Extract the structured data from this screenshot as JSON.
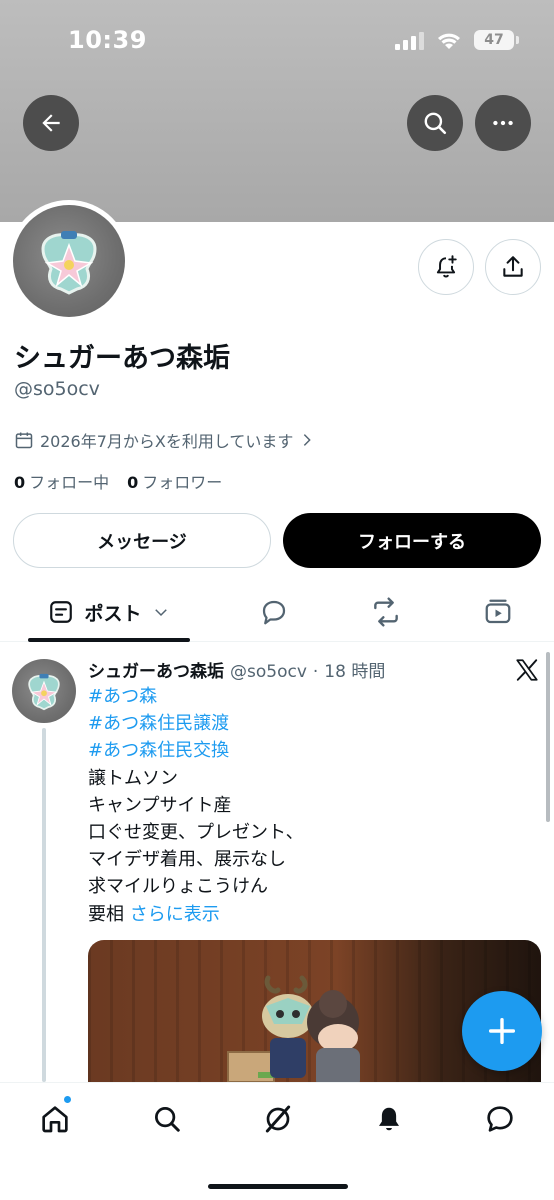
{
  "status_bar": {
    "time": "10:39",
    "battery": "47"
  },
  "profile": {
    "display_name": "シュガーあつ森垢",
    "handle": "@so5ocv",
    "joined": "2026年7月からXを利用しています",
    "following_count": "0",
    "following_label": "フォロー中",
    "followers_count": "0",
    "followers_label": "フォロワー"
  },
  "actions": {
    "message_label": "メッセージ",
    "follow_label": "フォローする"
  },
  "tabs": {
    "active_label": "ポスト"
  },
  "post": {
    "author_name": "シュガーあつ森垢",
    "author_handle": "@so5ocv",
    "separator": "·",
    "time_ago": "18 時間",
    "lines": [
      {
        "text": "#あつ森",
        "hashtag": true
      },
      {
        "text": "#あつ森住民譲渡",
        "hashtag": true
      },
      {
        "text": "#あつ森住民交換",
        "hashtag": true
      },
      {
        "text": "譲トムソン"
      },
      {
        "text": "キャンプサイト産"
      },
      {
        "text": "口ぐせ変更、プレゼント、"
      },
      {
        "text": "マイデザ着用、展示なし"
      },
      {
        "text": "求マイルりょこうけん"
      }
    ],
    "last_line": "要相",
    "show_more": "さらに表示"
  },
  "colors": {
    "accent": "#1d9bf0",
    "text_primary": "#0f1419",
    "text_secondary": "#536471",
    "border": "#cfd9de"
  },
  "icons": [
    "back-arrow-icon",
    "search-icon",
    "more-icon",
    "notification-add-icon",
    "share-icon",
    "calendar-icon",
    "chevron-right-icon",
    "posts-icon",
    "chevron-down-icon",
    "replies-icon",
    "reposts-icon",
    "media-icon",
    "x-logo-icon",
    "plus-icon",
    "home-icon",
    "explore-icon",
    "grok-icon",
    "bell-icon",
    "messages-icon"
  ]
}
